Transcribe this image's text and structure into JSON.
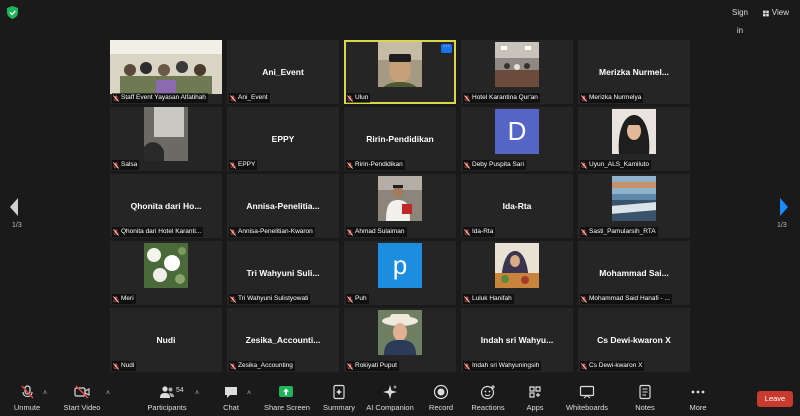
{
  "topbar": {
    "sign_in": "Sign in",
    "view": "View"
  },
  "pagination": {
    "left_page": "1/3",
    "right_page": "1/3"
  },
  "participants": [
    {
      "name": "",
      "label": "Staff Event Yayasan Alfatihah",
      "video": "group-photo"
    },
    {
      "name": "Ani_Event",
      "label": "Ani_Event"
    },
    {
      "name": "",
      "label": "Ulun",
      "video": "man-cap",
      "active": true
    },
    {
      "name": "",
      "label": "Hotel Karantina Qur'an",
      "video": "hall-photo"
    },
    {
      "name": "Merizka Nurmel...",
      "label": "Merizka Nurmelya"
    },
    {
      "name": "",
      "label": "Salsa",
      "video": "dark-room"
    },
    {
      "name": "EPPY",
      "label": "EPPY"
    },
    {
      "name": "Ririn-Pendidikan",
      "label": "Ririn-Pendidikan"
    },
    {
      "name": "",
      "label": "Deby Puspita Sari",
      "avatar": "D"
    },
    {
      "name": "",
      "label": "Uyun_ALS_Kamiluto",
      "video": "hijab-woman"
    },
    {
      "name": "Qhonita dari Ho...",
      "label": "Qhonita dari Hotel Karanti..."
    },
    {
      "name": "Annisa-Penelitia...",
      "label": "Annisa-Penelitian-Kwaron"
    },
    {
      "name": "",
      "label": "Ahmad Sulaiman",
      "video": "man-room"
    },
    {
      "name": "Ida-Rta",
      "label": "Ida-Rta"
    },
    {
      "name": "",
      "label": "Sasti_Pamularsih_RTA",
      "video": "sky-photo"
    },
    {
      "name": "",
      "label": "Meri",
      "video": "flowers"
    },
    {
      "name": "Tri Wahyuni Suli...",
      "label": "Tri Wahyuni Sulistyowati"
    },
    {
      "name": "",
      "label": "Puh",
      "avatar": "p"
    },
    {
      "name": "",
      "label": "Luluk Hanifah",
      "video": "woman-food"
    },
    {
      "name": "Mohammad Sai...",
      "label": "Mohammad Said Hanafi - ..."
    },
    {
      "name": "Nudi",
      "label": "Nudi"
    },
    {
      "name": "Zesika_Accounti...",
      "label": "Zesika_Accounting"
    },
    {
      "name": "",
      "label": "Rokiyati Puput",
      "video": "woman-hat"
    },
    {
      "name": "Indah sri Wahyu...",
      "label": "Indah sri Wahyuningsih"
    },
    {
      "name": "Cs Dewi-kwaron X",
      "label": "Cs Dewi-kwaron X"
    }
  ],
  "toolbar": {
    "unmute": "Unmute",
    "start_video": "Start Video",
    "participants": "Participants",
    "participant_count": "54",
    "chat": "Chat",
    "share_screen": "Share Screen",
    "summary": "Summary",
    "ai_companion": "AI Companion",
    "record": "Record",
    "reactions": "Reactions",
    "apps": "Apps",
    "whiteboards": "Whiteboards",
    "notes": "Notes",
    "more": "More",
    "leave": "Leave"
  },
  "colors": {
    "background": "#1a1a1a",
    "tile": "#252525",
    "active_speaker": "#d8d84a",
    "share_green": "#1fb45a",
    "leave_red": "#c93a2e",
    "mic_off_red": "#e04a3f",
    "page_arrow": "#1a8cff"
  }
}
